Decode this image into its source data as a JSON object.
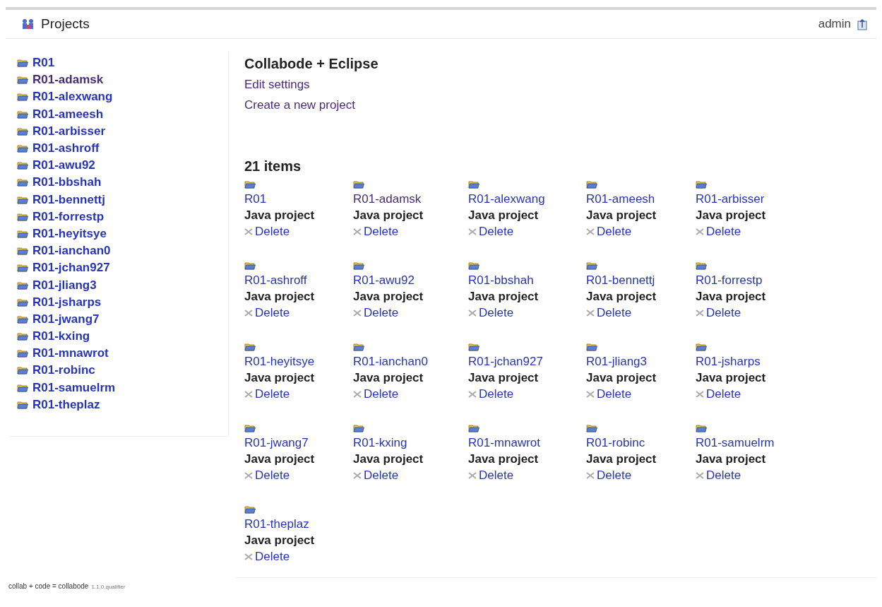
{
  "header": {
    "title": "Projects",
    "user": "admin"
  },
  "sidebar": {
    "items": [
      {
        "label": "R01",
        "visited": false
      },
      {
        "label": "R01-adamsk",
        "visited": true
      },
      {
        "label": "R01-alexwang",
        "visited": false
      },
      {
        "label": "R01-ameesh",
        "visited": false
      },
      {
        "label": "R01-arbisser",
        "visited": false
      },
      {
        "label": "R01-ashroff",
        "visited": false
      },
      {
        "label": "R01-awu92",
        "visited": false
      },
      {
        "label": "R01-bbshah",
        "visited": false
      },
      {
        "label": "R01-bennettj",
        "visited": false
      },
      {
        "label": "R01-forrestp",
        "visited": false
      },
      {
        "label": "R01-heyitsye",
        "visited": false
      },
      {
        "label": "R01-ianchan0",
        "visited": false
      },
      {
        "label": "R01-jchan927",
        "visited": false
      },
      {
        "label": "R01-jliang3",
        "visited": false
      },
      {
        "label": "R01-jsharps",
        "visited": false
      },
      {
        "label": "R01-jwang7",
        "visited": false
      },
      {
        "label": "R01-kxing",
        "visited": false
      },
      {
        "label": "R01-mnawrot",
        "visited": false
      },
      {
        "label": "R01-robinc",
        "visited": false
      },
      {
        "label": "R01-samuelrm",
        "visited": false
      },
      {
        "label": "R01-theplaz",
        "visited": false
      }
    ]
  },
  "main": {
    "title": "Collabode + Eclipse",
    "links": [
      {
        "label": "Edit settings",
        "visited": true
      },
      {
        "label": "Create a new project",
        "visited": true
      }
    ],
    "count": "21 items",
    "projects": [
      {
        "name": "R01",
        "type": "Java project",
        "action": "Delete",
        "visited": false
      },
      {
        "name": "R01-adamsk",
        "type": "Java project",
        "action": "Delete",
        "visited": true
      },
      {
        "name": "R01-alexwang",
        "type": "Java project",
        "action": "Delete",
        "visited": false
      },
      {
        "name": "R01-ameesh",
        "type": "Java project",
        "action": "Delete",
        "visited": false
      },
      {
        "name": "R01-arbisser",
        "type": "Java project",
        "action": "Delete",
        "visited": false
      },
      {
        "name": "R01-ashroff",
        "type": "Java project",
        "action": "Delete",
        "visited": false
      },
      {
        "name": "R01-awu92",
        "type": "Java project",
        "action": "Delete",
        "visited": false
      },
      {
        "name": "R01-bbshah",
        "type": "Java project",
        "action": "Delete",
        "visited": false
      },
      {
        "name": "R01-bennettj",
        "type": "Java project",
        "action": "Delete",
        "visited": false
      },
      {
        "name": "R01-forrestp",
        "type": "Java project",
        "action": "Delete",
        "visited": false
      },
      {
        "name": "R01-heyitsye",
        "type": "Java project",
        "action": "Delete",
        "visited": false
      },
      {
        "name": "R01-ianchan0",
        "type": "Java project",
        "action": "Delete",
        "visited": false
      },
      {
        "name": "R01-jchan927",
        "type": "Java project",
        "action": "Delete",
        "visited": false
      },
      {
        "name": "R01-jliang3",
        "type": "Java project",
        "action": "Delete",
        "visited": false
      },
      {
        "name": "R01-jsharps",
        "type": "Java project",
        "action": "Delete",
        "visited": false
      },
      {
        "name": "R01-jwang7",
        "type": "Java project",
        "action": "Delete",
        "visited": false
      },
      {
        "name": "R01-kxing",
        "type": "Java project",
        "action": "Delete",
        "visited": false
      },
      {
        "name": "R01-mnawrot",
        "type": "Java project",
        "action": "Delete",
        "visited": false
      },
      {
        "name": "R01-robinc",
        "type": "Java project",
        "action": "Delete",
        "visited": false
      },
      {
        "name": "R01-samuelrm",
        "type": "Java project",
        "action": "Delete",
        "visited": false
      },
      {
        "name": "R01-theplaz",
        "type": "Java project",
        "action": "Delete",
        "visited": false
      }
    ]
  },
  "footer": {
    "text": "collab + code = collabode",
    "version": "1.1.0.qualifier"
  }
}
